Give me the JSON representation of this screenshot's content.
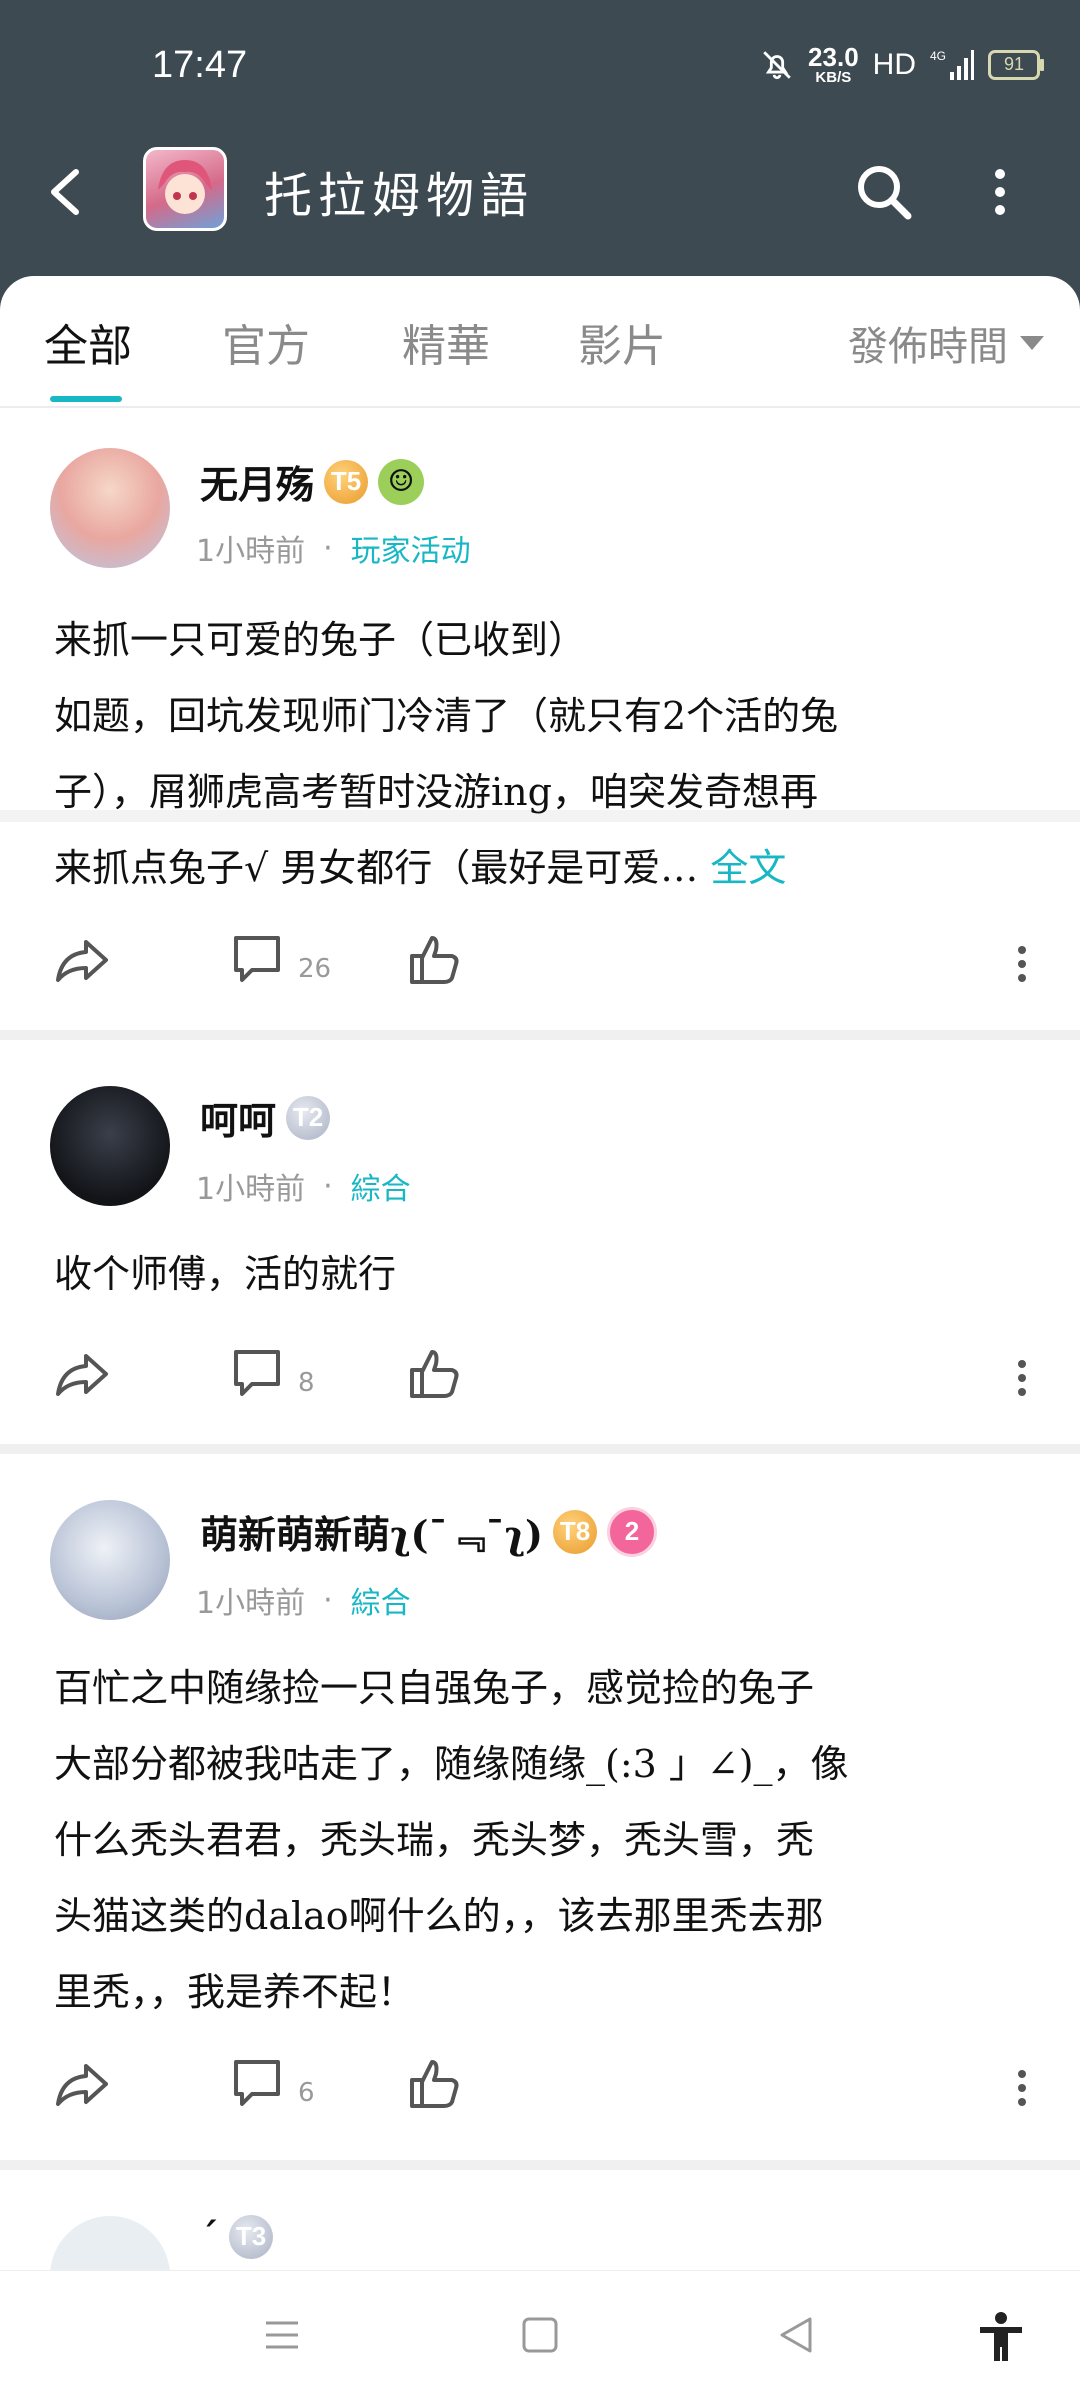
{
  "status_bar": {
    "time": "17:47",
    "net_speed": "23.0",
    "net_unit": "KB/S",
    "hd": "HD",
    "signal": "4G",
    "battery": "91"
  },
  "header": {
    "title": "托拉姆物語"
  },
  "tabs": [
    {
      "label": "全部"
    },
    {
      "label": "官方"
    },
    {
      "label": "精華"
    },
    {
      "label": "影片"
    }
  ],
  "sort": {
    "label": "發佈時間"
  },
  "posts": [
    {
      "author": "无月殇",
      "level": "T5",
      "time": "1小時前",
      "tag": "玩家活动",
      "lines": [
        "来抓一只可爱的兔子（已收到）",
        "如题，回坑发现师门冷清了（就只有2个活的兔",
        "子），屑狮虎高考暂时没游ing，咱突发奇想再",
        "来抓点兔子√ 男女都行（最好是可爱…"
      ],
      "full_text_label": "全文",
      "comments": "26"
    },
    {
      "author": "呵呵",
      "level": "T2",
      "time": "1小時前",
      "tag": "綜合",
      "lines": [
        "收个师傅，活的就行"
      ],
      "comments": "8"
    },
    {
      "author": "萌新萌新萌ʅ(¯﹃¯ʅ)",
      "level": "T8",
      "level2": "2",
      "time": "1小時前",
      "tag": "綜合",
      "lines": [
        "百忙之中随缘捡一只自强兔子，感觉捡的兔子",
        "大部分都被我咕走了，随缘随缘_(:3 」∠)_，像",
        "什么秃头君君，秃头瑞，秃头梦，秃头雪，秃",
        "头猫这类的dalao啊什么的，，该去那里秃去那",
        "里秃，，我是养不起！"
      ],
      "comments": "6"
    },
    {
      "author": "ˊ",
      "level": "T3"
    }
  ],
  "colors": {
    "accent": "#18b7c4",
    "header_bg": "#3d4a51"
  }
}
